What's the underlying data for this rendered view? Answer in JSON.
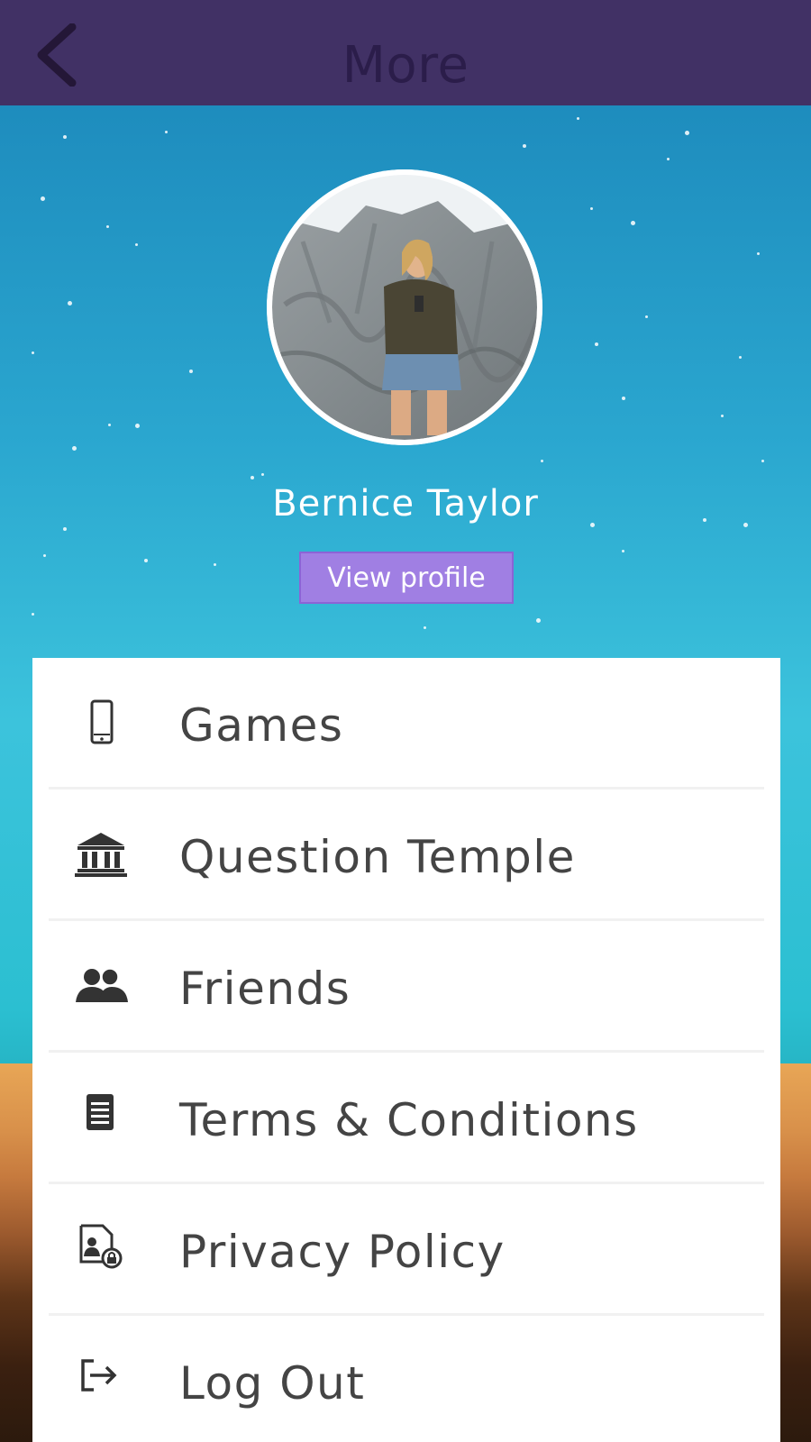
{
  "header": {
    "title": "More",
    "back_icon": "chevron-left-icon"
  },
  "profile": {
    "name": "Bernice Taylor",
    "view_profile_label": "View profile"
  },
  "menu": {
    "items": [
      {
        "label": "Games",
        "icon": "mobile-phone-icon"
      },
      {
        "label": "Question Temple",
        "icon": "temple-icon"
      },
      {
        "label": "Friends",
        "icon": "friends-icon"
      },
      {
        "label": "Terms & Conditions",
        "icon": "document-icon"
      },
      {
        "label": "Privacy Policy",
        "icon": "privacy-document-icon"
      },
      {
        "label": "Log Out",
        "icon": "logout-icon"
      }
    ]
  },
  "colors": {
    "header_bg": "#413165",
    "sky_top": "#1a84b8",
    "sky_mid": "#3cc3dc",
    "button_bg": "#a07fe3",
    "menu_text": "#444444"
  }
}
